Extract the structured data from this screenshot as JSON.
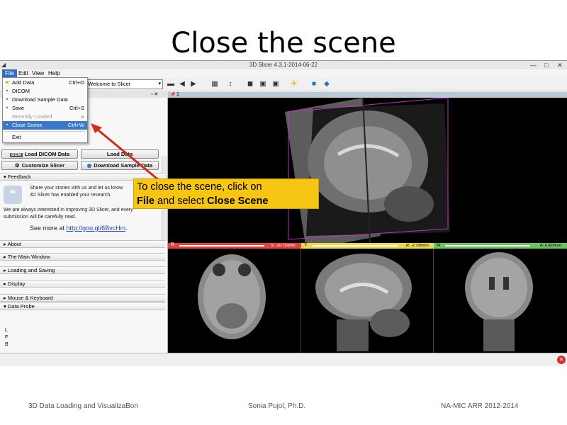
{
  "slide": {
    "title": "Close the scene"
  },
  "window": {
    "title": "3D Slicer 4.3.1-2014-06-22",
    "minimize": "—",
    "maximize": "□",
    "close": "✕"
  },
  "menubar": {
    "file": "File",
    "edit": "Edit",
    "view": "View",
    "help": "Help"
  },
  "toolbar": {
    "module": "Welcome to Slicer"
  },
  "file_menu": {
    "add_data": "Add Data",
    "add_data_sc": "Ctrl+O",
    "dicom": "DICOM",
    "download": "Download Sample Data",
    "save": "Save",
    "save_sc": "Ctrl+S",
    "recent": "Recently Loaded",
    "close_scene": "Close Scene",
    "close_scene_sc": "Ctrl+W",
    "exit": "Exit"
  },
  "panel": {
    "load_dicom": "Load DICOM Data",
    "load_data": "Load Data",
    "customize": "Customize Slicer",
    "download_sample": "Download Sample Data",
    "feedback": "Feedback",
    "feedback_text1": "Share your stories with us and let us know",
    "feedback_text2": "3D Slicer has enabled your research.",
    "feedback_text3": "We are always interested in improving 3D Slicer, and every",
    "feedback_text4": "submission will be carefully read.",
    "see_more": "See more at",
    "link": "http://goo.gl/6BvcHm",
    "link_end": ".",
    "sections": [
      "About",
      "The Main Window",
      "Loading and Saving",
      "Display",
      "Mouse & Keyboard"
    ],
    "data_probe": "Data Probe",
    "probe_lines": [
      "L",
      "F",
      "B"
    ]
  },
  "views": {
    "three_d_label": "1",
    "red": {
      "letter": "R",
      "value": "S: -10.714mm",
      "color": "#e64141"
    },
    "yellow": {
      "letter": "Y",
      "value": "R: -2.795mm",
      "color": "#ecd84a"
    },
    "green": {
      "letter": "G",
      "value": "A: 6.429mm",
      "color": "#6bc35d"
    }
  },
  "callout": {
    "line1": "To close the scene, click on",
    "file": "File",
    "mid": " and select ",
    "close": "Close Scene"
  },
  "footer": {
    "left": "3D Data Loading and VisualizaBon",
    "center": "Sonia Pujol, Ph.D.",
    "right": "NA-MIC ARR 2012-2014"
  }
}
